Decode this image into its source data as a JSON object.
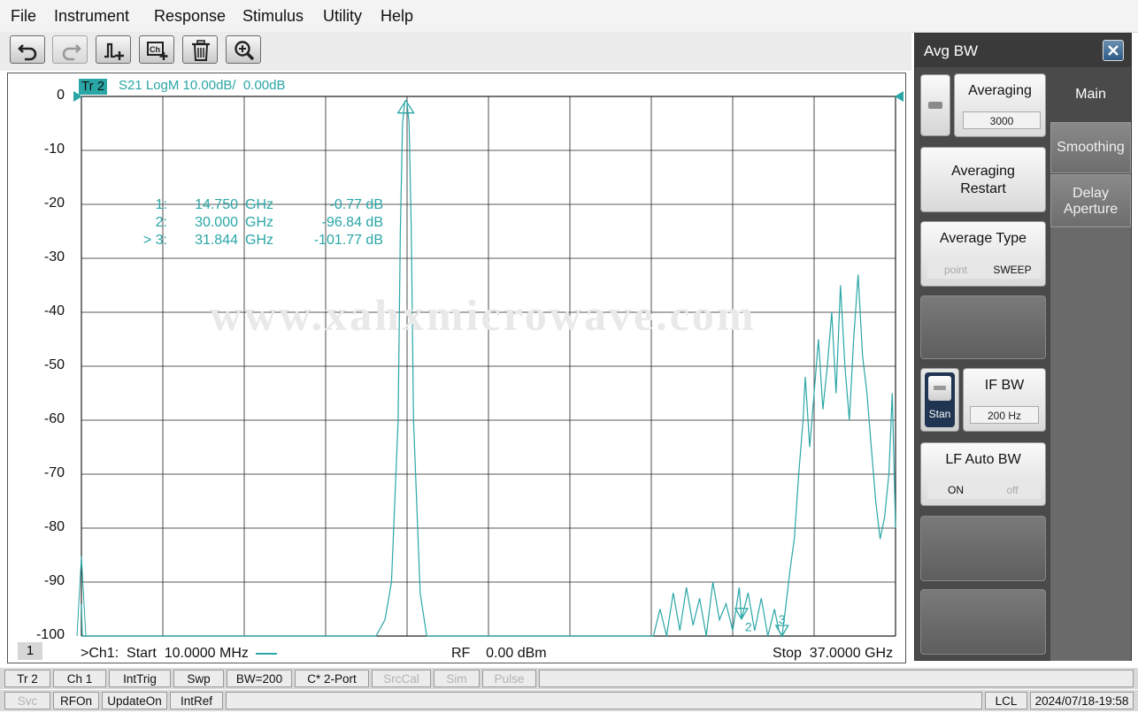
{
  "menu": [
    "File",
    "Instrument",
    "Response",
    "Stimulus",
    "Utility",
    "Help"
  ],
  "toolbar": {
    "buttons": [
      "undo-icon",
      "redo-icon",
      "add-marker-icon",
      "add-trace-icon",
      "delete-icon",
      "zoom-icon"
    ]
  },
  "trace": {
    "tag": "Tr 2",
    "header": "S21 LogM 10.00dB/  0.00dB",
    "color": "#2aa6a6"
  },
  "chart_data": {
    "type": "line",
    "title": "",
    "xlabel": "",
    "ylabel": "",
    "x_unit": "GHz",
    "xlim": [
      0.01,
      37.0
    ],
    "ylim": [
      -102,
      0
    ],
    "y_ticks": [
      "0",
      "-10",
      "-20",
      "-30",
      "-40",
      "-50",
      "-60",
      "-70",
      "-80",
      "-90",
      "-100"
    ],
    "grid": true,
    "series": [
      {
        "color": "#2aa6a6",
        "x": [
          0.01,
          0.05,
          0.1,
          0.5,
          2.4,
          2.5,
          2.6,
          5.0,
          7.0,
          9.5,
          10.0,
          10.5,
          11.0,
          11.5,
          13.4,
          13.8,
          14.1,
          14.4,
          14.5,
          14.6,
          14.7,
          14.75,
          14.8,
          14.9,
          15.0,
          15.1,
          15.4,
          15.7,
          18.0,
          18.2,
          20.0,
          23.0,
          25.0,
          26.0,
          26.3,
          26.6,
          26.9,
          27.2,
          27.5,
          27.8,
          28.1,
          28.4,
          28.7,
          29.0,
          29.3,
          29.6,
          29.9,
          30.0,
          30.3,
          30.6,
          30.9,
          31.2,
          31.5,
          31.7,
          31.844,
          32.0,
          32.2,
          32.4,
          32.6,
          32.8,
          32.9,
          33.1,
          33.3,
          33.5,
          33.7,
          33.9,
          34.1,
          34.3,
          34.5,
          34.7,
          34.9,
          35.1,
          35.3,
          35.5,
          35.7,
          35.9,
          36.1,
          36.3,
          36.5,
          36.7,
          36.85,
          37.0
        ],
        "y": [
          -94,
          -102,
          -102,
          -102,
          -102,
          -100,
          -102,
          -102,
          -101,
          -102,
          -100,
          -102,
          -100,
          -102,
          -102,
          -97,
          -90,
          -60,
          -25,
          -5,
          -1,
          -0.77,
          -1,
          -5,
          -25,
          -60,
          -92,
          -102,
          -102,
          -101,
          -102,
          -102,
          -101,
          -102,
          -95,
          -100,
          -92,
          -99,
          -91,
          -98,
          -93,
          -100,
          -90,
          -97,
          -94,
          -99,
          -91,
          -96.84,
          -92,
          -99,
          -93,
          -100,
          -95,
          -99,
          -101.77,
          -95,
          -88,
          -82,
          -70,
          -60,
          -52,
          -65,
          -55,
          -45,
          -58,
          -50,
          -40,
          -55,
          -35,
          -50,
          -60,
          -45,
          -33,
          -48,
          -55,
          -65,
          -75,
          -82,
          -78,
          -70,
          -55,
          -80
        ]
      }
    ],
    "markers": [
      {
        "label": "1",
        "x": 14.75,
        "y": -0.77
      },
      {
        "label": "2",
        "x": 30.0,
        "y": -96.84
      },
      {
        "label": "3",
        "x": 31.844,
        "y": -101.77
      }
    ]
  },
  "marker_table": [
    {
      "id": "1:",
      "freq": "14.750",
      "unit": "GHz",
      "value": "-0.77 dB"
    },
    {
      "id": "2:",
      "freq": "30.000",
      "unit": "GHz",
      "value": "-96.84 dB"
    },
    {
      "id": "> 3:",
      "freq": "31.844",
      "unit": "GHz",
      "value": "-101.77 dB"
    }
  ],
  "watermark": "www.xahxmicrowave.com",
  "channel_badge": "1",
  "footer": {
    "start": ">Ch1:  Start  10.0000 MHz",
    "rf": "RF    0.00 dBm",
    "stop": "Stop  37.0000 GHz"
  },
  "panel": {
    "title": "Avg BW",
    "tabs": [
      "Main",
      "Smoothing",
      "Delay\nAperture"
    ],
    "averaging_label": "Averaging",
    "averaging_value": "3000",
    "averaging_restart": "Averaging\nRestart",
    "average_type_label": "Average Type",
    "average_type_options": [
      "point",
      "SWEEP"
    ],
    "stan_label": "Stan",
    "if_bw_label": "IF BW",
    "if_bw_value": "200 Hz",
    "lf_auto_label": "LF Auto BW",
    "lf_auto_options": [
      "ON",
      "off"
    ]
  },
  "status_row1": [
    "Tr 2",
    "Ch 1",
    "IntTrig",
    "Swp",
    "BW=200",
    "C* 2-Port",
    "SrcCal",
    "Sim",
    "Pulse"
  ],
  "status_row2": [
    "Svc",
    "RFOn",
    "UpdateOn",
    "IntRef",
    "LCL",
    "2024/07/18-19:58"
  ]
}
